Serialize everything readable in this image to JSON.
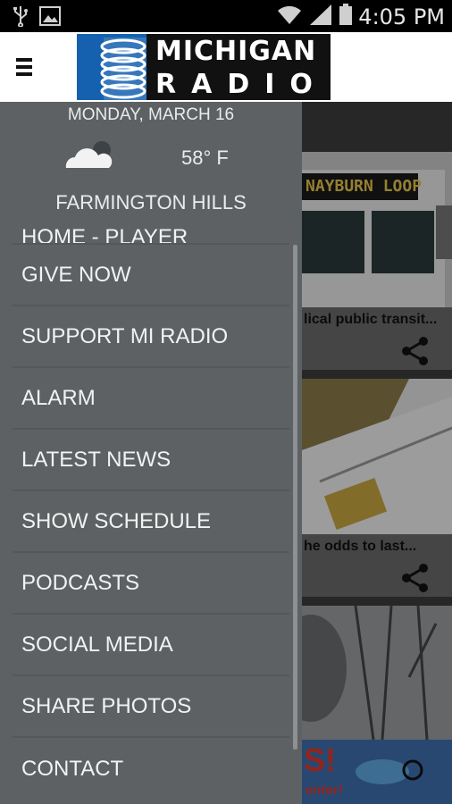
{
  "status_bar": {
    "time": "4:05 PM",
    "icons": [
      "usb-icon",
      "image-icon",
      "wifi-icon",
      "signal-icon",
      "battery-icon"
    ]
  },
  "header": {
    "logo_line1": "MICHIGAN",
    "logo_line2": "RADIO"
  },
  "drawer": {
    "date": "MONDAY, MARCH 16",
    "temperature": "58° F",
    "location": "FARMINGTON HILLS",
    "menu_items": [
      {
        "label": "HOME - PLAYER"
      },
      {
        "label": "GIVE NOW"
      },
      {
        "label": "SUPPORT MI RADIO"
      },
      {
        "label": "ALARM"
      },
      {
        "label": "LATEST NEWS"
      },
      {
        "label": "SHOW SCHEDULE"
      },
      {
        "label": "PODCASTS"
      },
      {
        "label": "SOCIAL MEDIA"
      },
      {
        "label": "SHARE PHOTOS"
      },
      {
        "label": "CONTACT"
      }
    ]
  },
  "content": {
    "stories": [
      {
        "sign": "NAYBURN LOOP",
        "caption": "lical public transit..."
      },
      {
        "caption": "he odds to last..."
      },
      {
        "banner_text": "S!",
        "banner_sub": "enter!"
      }
    ]
  },
  "colors": {
    "drawer_bg": "#5d6163",
    "header_bg": "#ffffff",
    "logo_blue": "#1561b0"
  }
}
